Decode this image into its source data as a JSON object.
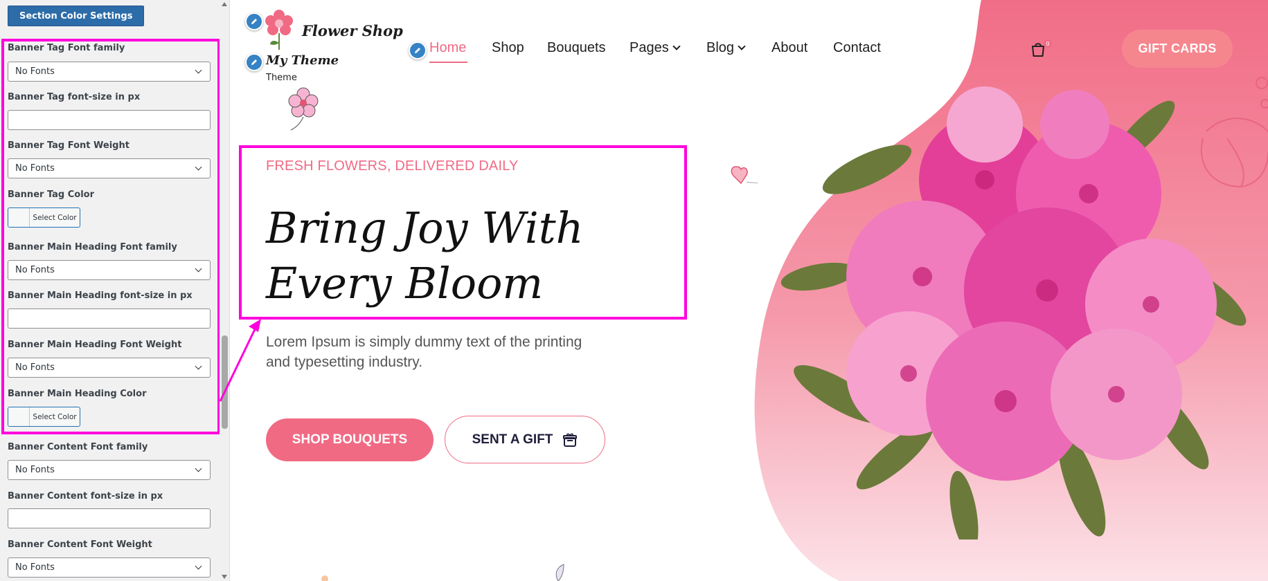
{
  "panel": {
    "section_button": "Section Color Settings",
    "fields": [
      {
        "label": "Banner Tag Font family",
        "type": "select",
        "value": "No Fonts"
      },
      {
        "label": "Banner Tag font-size in px",
        "type": "text",
        "value": ""
      },
      {
        "label": "Banner Tag Font Weight",
        "type": "select",
        "value": "No Fonts"
      },
      {
        "label": "Banner Tag Color",
        "type": "color",
        "value": "Select Color"
      },
      {
        "label": "Banner Main Heading Font family",
        "type": "select",
        "value": "No Fonts"
      },
      {
        "label": "Banner Main Heading font-size in px",
        "type": "text",
        "value": ""
      },
      {
        "label": "Banner Main Heading Font Weight",
        "type": "select",
        "value": "No Fonts"
      },
      {
        "label": "Banner Main Heading Color",
        "type": "color",
        "value": "Select Color"
      },
      {
        "label": "Banner Content Font family",
        "type": "select",
        "value": "No Fonts"
      },
      {
        "label": "Banner Content font-size in px",
        "type": "text",
        "value": ""
      },
      {
        "label": "Banner Content Font Weight",
        "type": "select",
        "value": "No Fonts"
      }
    ]
  },
  "site": {
    "logo": {
      "shop_name": "Flower Shop",
      "theme_name": "My Theme",
      "theme_sub": "Theme"
    },
    "nav": {
      "items": [
        "Home",
        "Shop",
        "Bouquets",
        "Pages",
        "Blog",
        "About",
        "Contact"
      ],
      "active": "Home",
      "cart_count": "0",
      "gift_cards": "GIFT CARDS"
    },
    "hero": {
      "tag": "FRESH FLOWERS, DELIVERED DAILY",
      "heading": "Bring Joy With Every Bloom",
      "text": "Lorem Ipsum is simply dummy text of the printing and typesetting industry.",
      "primary_button": "SHOP BOUQUETS",
      "secondary_button": "SENT A GIFT"
    }
  },
  "colors": {
    "accent": "#f06a84",
    "gift_button": "#f6868e",
    "highlight": "#ff00dd",
    "customizer_button": "#2c6ca8"
  },
  "icons": [
    "pencil-icon",
    "cart-icon",
    "gift-box-icon",
    "chevron-down-icon",
    "flower-logo-icon"
  ]
}
